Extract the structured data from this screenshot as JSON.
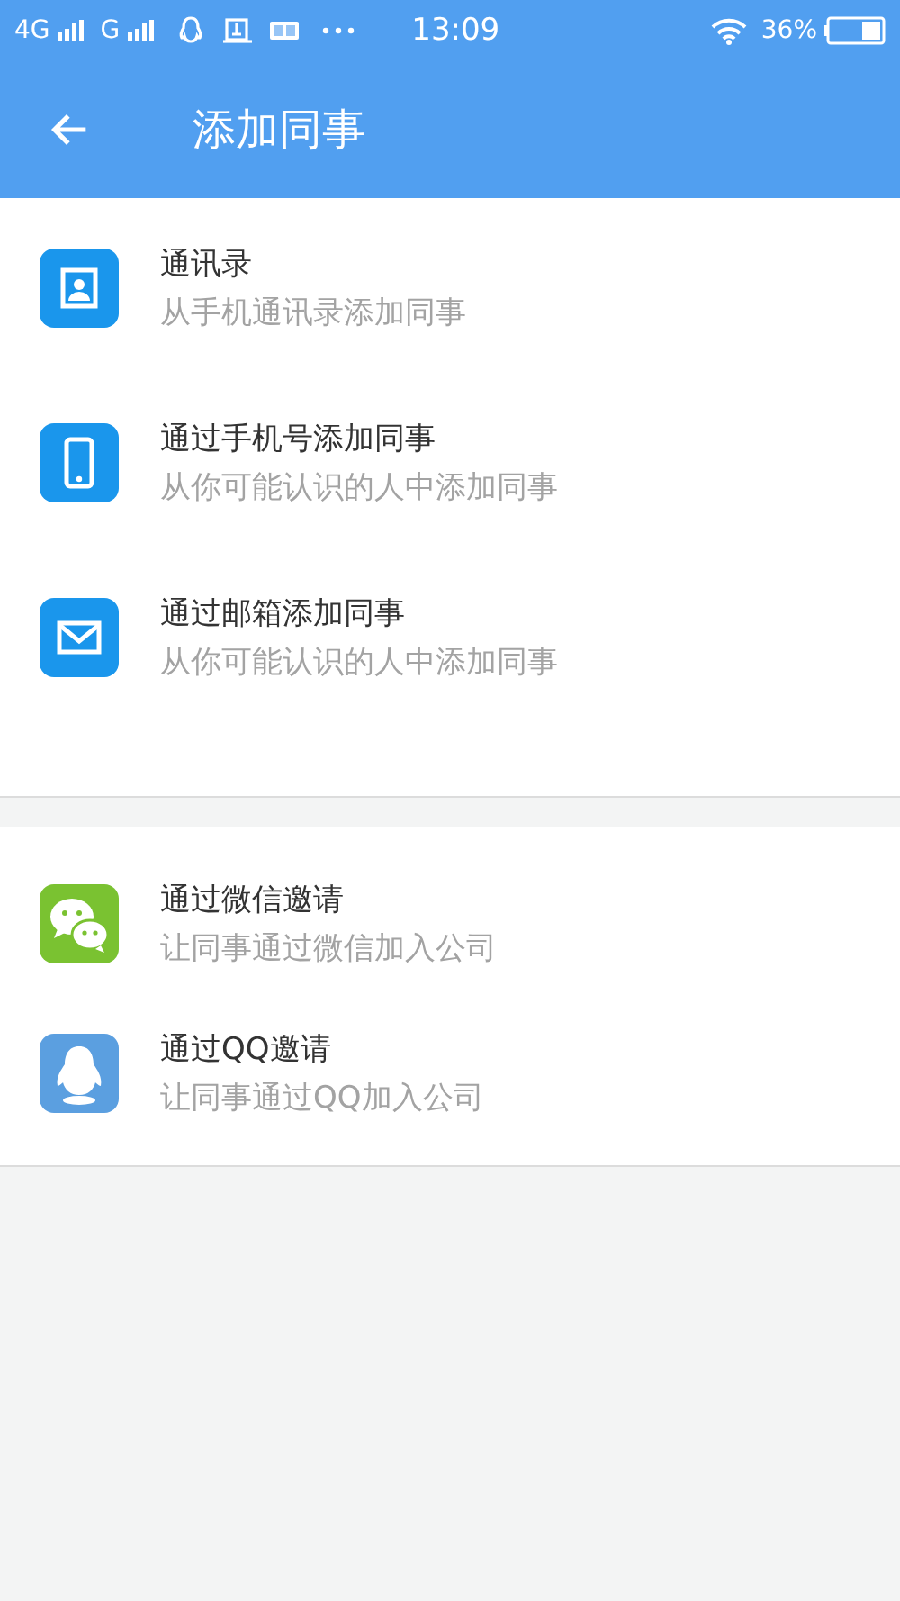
{
  "status_bar": {
    "network_1": "4G",
    "network_2": "G",
    "time": "13:09",
    "battery": "36%"
  },
  "header": {
    "title": "添加同事"
  },
  "sections": [
    {
      "items": [
        {
          "kind": "contacts",
          "title": "通讯录",
          "subtitle": "从手机通讯录添加同事"
        },
        {
          "kind": "phone",
          "title": "通过手机号添加同事",
          "subtitle": "从你可能认识的人中添加同事"
        },
        {
          "kind": "mail",
          "title": "通过邮箱添加同事",
          "subtitle": "从你可能认识的人中添加同事"
        }
      ]
    },
    {
      "items": [
        {
          "kind": "wechat",
          "title": "通过微信邀请",
          "subtitle": "让同事通过微信加入公司"
        },
        {
          "kind": "qq",
          "title": "通过QQ邀请",
          "subtitle": "让同事通过QQ加入公司"
        }
      ]
    }
  ]
}
